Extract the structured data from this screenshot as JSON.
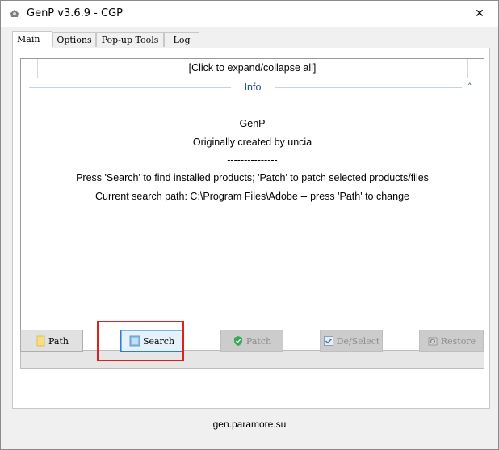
{
  "window": {
    "title": "GenP v3.6.9 - CGP",
    "close_glyph": "✕"
  },
  "tabs": [
    {
      "label": "Main",
      "active": true
    },
    {
      "label": "Options",
      "active": false
    },
    {
      "label": "Pop-up Tools",
      "active": false
    },
    {
      "label": "Log",
      "active": false
    }
  ],
  "info": {
    "expand_link": "[Click to expand/collapse all]",
    "section_label": "Info",
    "collapse_glyph": "˄",
    "lines": [
      "GenP",
      "Originally created by uncia",
      "---------------",
      "Press 'Search' to find installed products; 'Patch' to patch selected products/files",
      "Current search path: C:\\Program Files\\Adobe -- press 'Path' to change"
    ]
  },
  "progress": {
    "value": 0
  },
  "buttons": {
    "path": "Path",
    "search": "Search",
    "patch": "Patch",
    "deselect": "De/Select",
    "restore": "Restore"
  },
  "footer": {
    "link": "gen.paramore.su"
  },
  "colors": {
    "accent": "#1f4fa0",
    "highlight": "#e0201a",
    "focus": "#2f7bd6",
    "patch_icon": "#3aa857"
  }
}
